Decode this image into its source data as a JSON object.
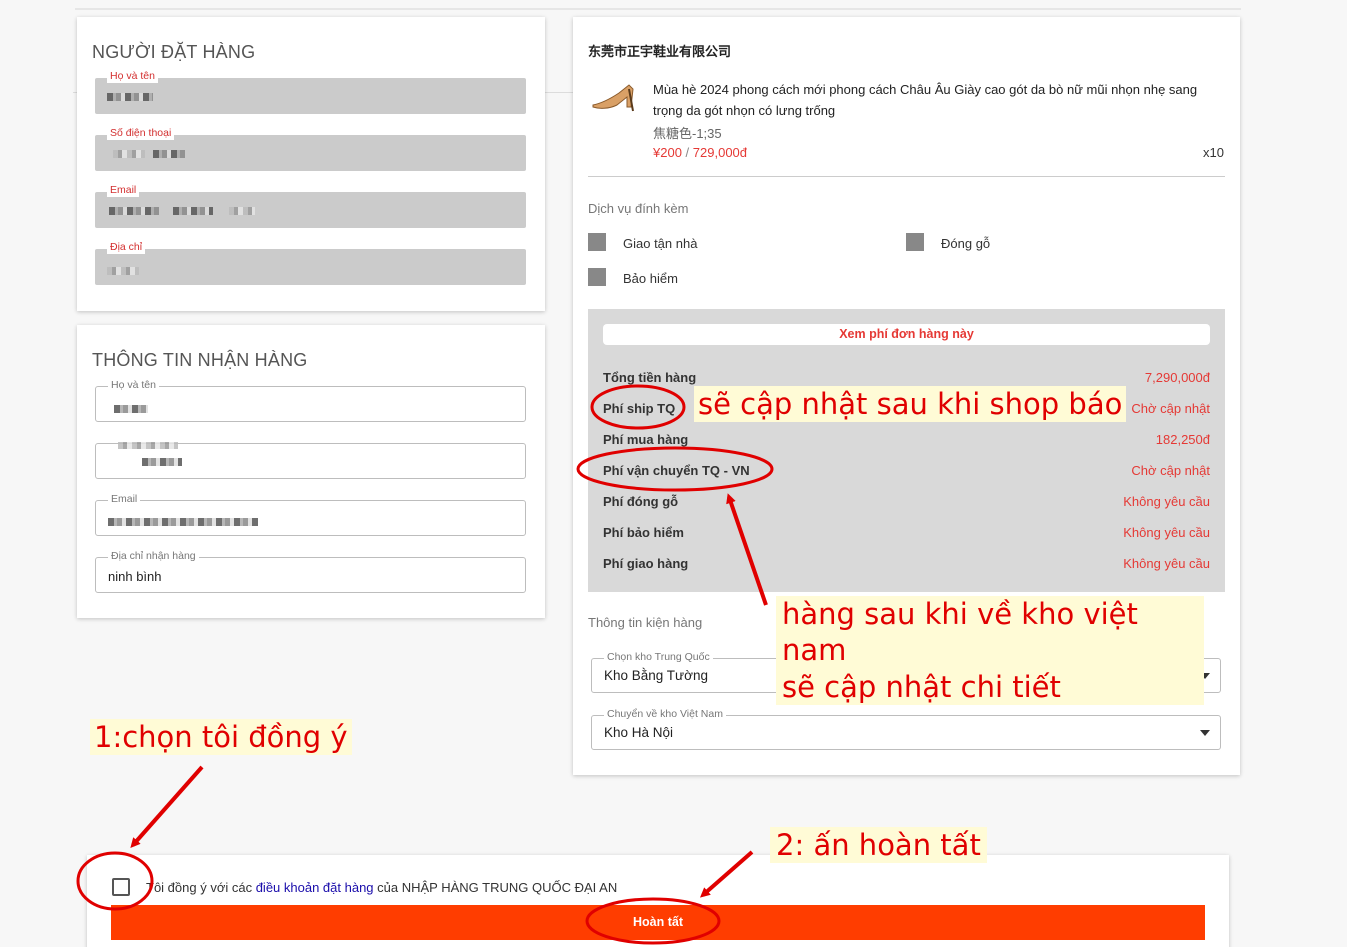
{
  "orderer": {
    "title": "NGƯỜI ĐẶT HÀNG",
    "fields": [
      {
        "label": "Họ và tên"
      },
      {
        "label": "Số điện thoại"
      },
      {
        "label": "Email"
      },
      {
        "label": "Địa chỉ"
      }
    ]
  },
  "receiver": {
    "title": "THÔNG TIN NHẬN HÀNG",
    "fields": [
      {
        "label": "Họ và tên",
        "value": ""
      },
      {
        "label": "",
        "value": ""
      },
      {
        "label": "Email",
        "value": ""
      },
      {
        "label": "Địa chỉ nhận hàng",
        "value": "ninh bình"
      }
    ]
  },
  "shop": {
    "name": "东莞市正宇鞋业有限公司",
    "product": {
      "title": "Mùa hè 2024 phong cách mới phong cách Châu Âu Giày cao gót da bò nữ mũi nhọn nhẹ sang trọng da gót nhọn có lưng trống",
      "variant": "焦糖色-1;35",
      "price_cny": "¥200",
      "price_sep": "/",
      "price_vnd": "729,000đ",
      "quantity": "x10"
    }
  },
  "services": {
    "title": "Dịch vụ đính kèm",
    "items": [
      {
        "label": "Giao tận nhà"
      },
      {
        "label": "Đóng gỗ"
      },
      {
        "label": "Bảo hiểm"
      }
    ]
  },
  "fees": {
    "button": "Xem phí đơn hàng này",
    "rows": [
      {
        "label": "Tổng tiền hàng",
        "value": "7,290,000đ"
      },
      {
        "label": "Phí ship TQ",
        "value": "Chờ cập nhật"
      },
      {
        "label": "Phí mua hàng",
        "value": "182,250đ"
      },
      {
        "label": "Phí vận chuyển TQ - VN",
        "value": "Chờ cập nhật"
      },
      {
        "label": "Phí đóng gỗ",
        "value": "Không yêu cầu"
      },
      {
        "label": "Phí bảo hiểm",
        "value": "Không yêu cầu"
      },
      {
        "label": "Phí giao hàng",
        "value": "Không yêu cầu"
      }
    ]
  },
  "package": {
    "title": "Thông tin kiện hàng",
    "cn_warehouse_label": "Chọn kho Trung Quốc",
    "cn_warehouse_value": "Kho Bằng Tường",
    "vn_warehouse_label": "Chuyển về kho Việt Nam",
    "vn_warehouse_value": "Kho Hà Nội"
  },
  "agree": {
    "prefix": "Tôi đồng ý với các",
    "link": "điều khoản đặt hàng",
    "suffix": "của NHẬP HÀNG TRUNG QUỐC ĐẠI AN",
    "submit": "Hoàn tất"
  },
  "annotations": {
    "ship_note": "sẽ cập nhật sau khi shop báo",
    "vn_note_line1": "hàng sau khi về kho việt nam",
    "vn_note_line2": "sẽ cập nhật chi tiết",
    "step1": "1:chọn tôi đồng ý",
    "step2": "2: ấn hoàn tất"
  },
  "colors": {
    "accent": "#ff3d00",
    "annotation": "#e00000",
    "price": "#e53935",
    "link": "#1a0dab"
  }
}
